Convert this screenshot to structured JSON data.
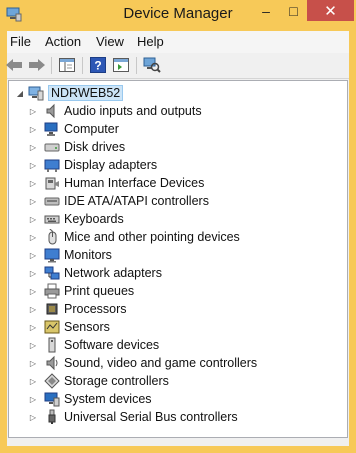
{
  "window": {
    "title": "Device Manager"
  },
  "titlebar": {
    "minimize": "–",
    "maximize": "□",
    "close": "✕"
  },
  "menu": [
    "File",
    "Action",
    "View",
    "Help"
  ],
  "tree": {
    "root": "NDRWEB52",
    "items": [
      "Audio inputs and outputs",
      "Computer",
      "Disk drives",
      "Display adapters",
      "Human Interface Devices",
      "IDE ATA/ATAPI controllers",
      "Keyboards",
      "Mice and other pointing devices",
      "Monitors",
      "Network adapters",
      "Print queues",
      "Processors",
      "Sensors",
      "Software devices",
      "Sound, video and game controllers",
      "Storage controllers",
      "System devices",
      "Universal Serial Bus controllers"
    ]
  },
  "colors": {
    "window_frame": "#f7c958",
    "close_button": "#c7504a",
    "selection": "#cce4f7"
  }
}
